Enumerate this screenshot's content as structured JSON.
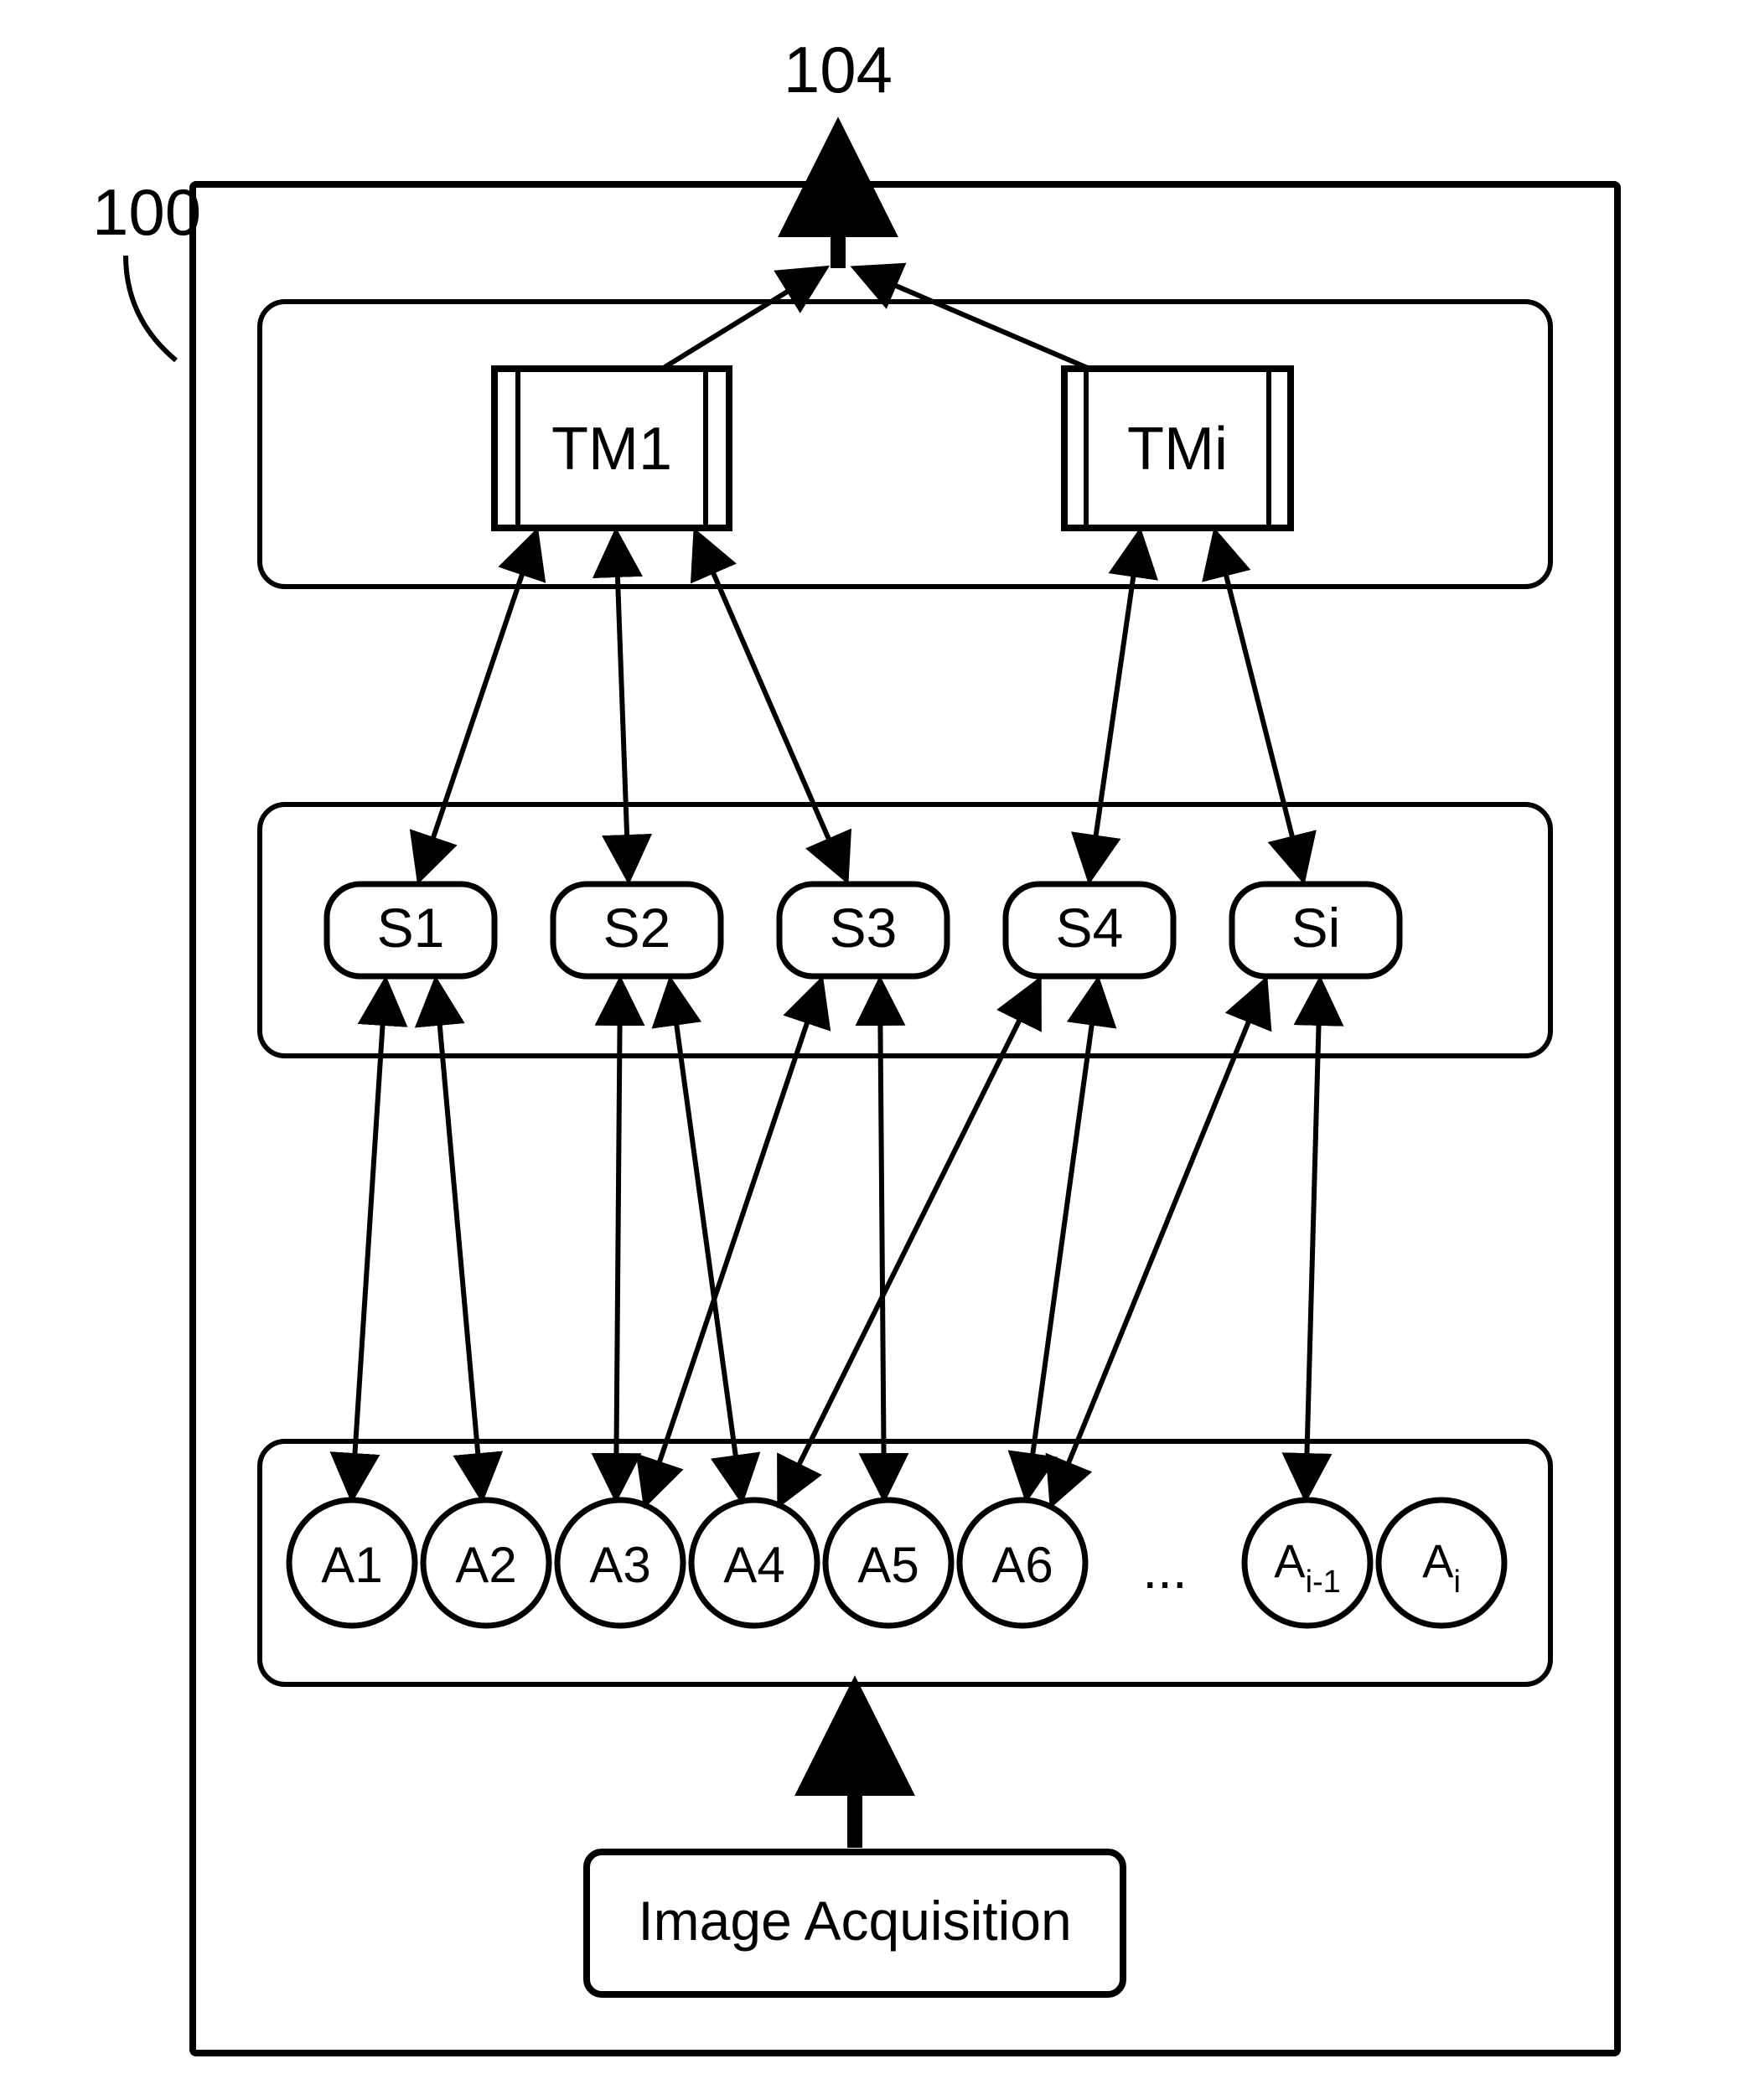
{
  "labels": {
    "ref100": "100",
    "ref104": "104",
    "tm1": "TM1",
    "tmi": "TMi",
    "s1": "S1",
    "s2": "S2",
    "s3": "S3",
    "s4": "S4",
    "si": "Si",
    "a1": "A1",
    "a2": "A2",
    "a3": "A3",
    "a4": "A4",
    "a5": "A5",
    "a6": "A6",
    "aimin1": "A",
    "aimin1_sub": "i-1",
    "ai": "A",
    "ai_sub": "i",
    "ellipsis": "...",
    "img_acq": "Image Acquisition"
  }
}
